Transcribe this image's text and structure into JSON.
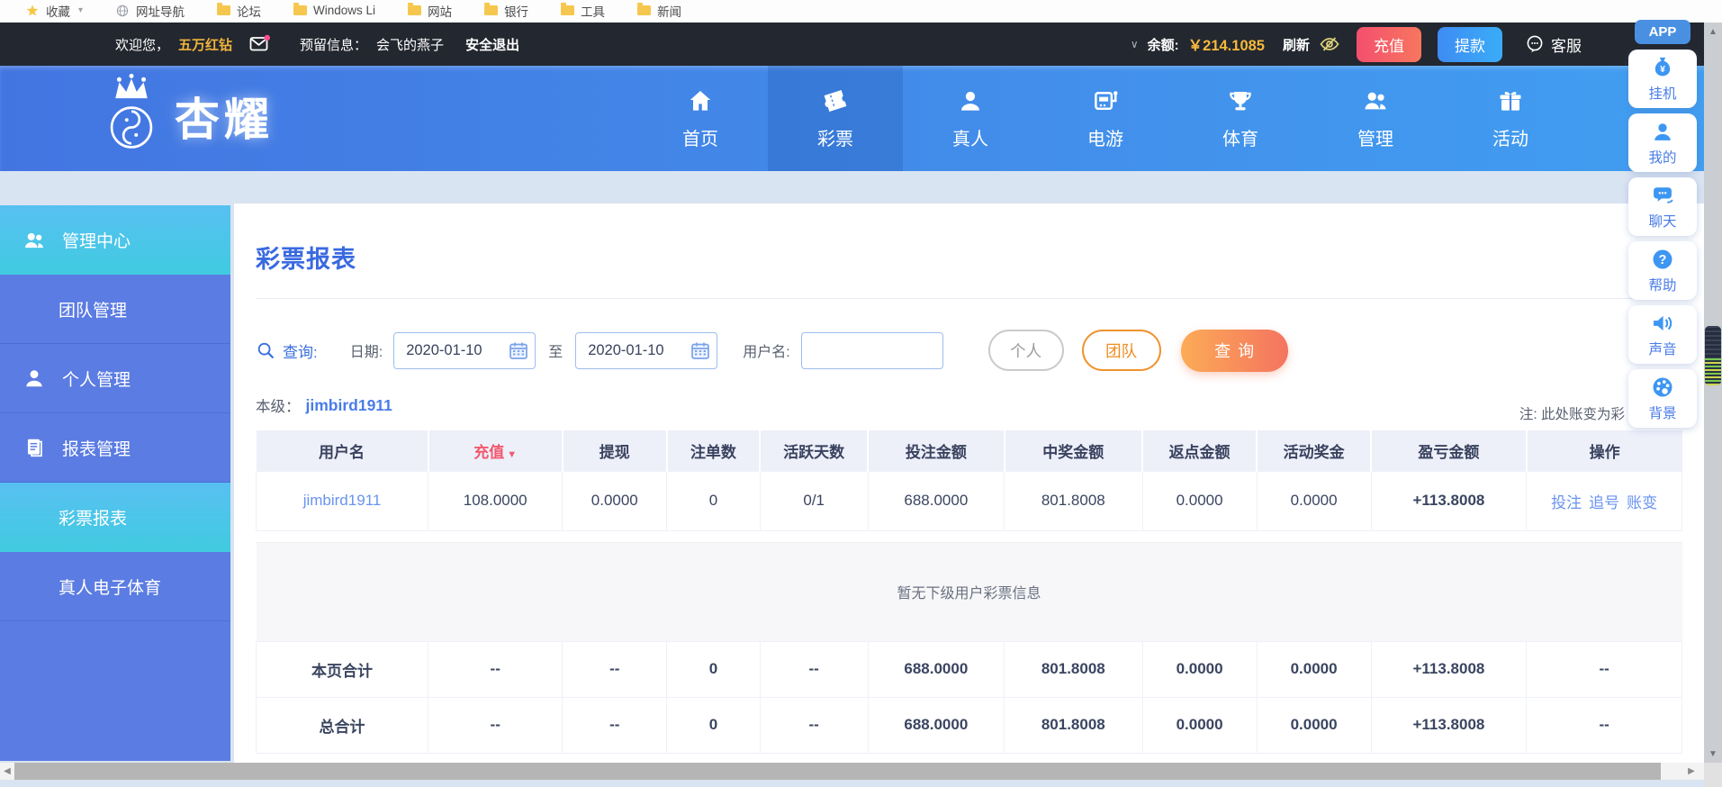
{
  "bookmarks": {
    "items": [
      {
        "label": "收藏",
        "icon": "star-icon"
      },
      {
        "label": "网址导航",
        "icon": "globe-icon"
      },
      {
        "label": "论坛",
        "icon": "folder-icon"
      },
      {
        "label": "Windows Li",
        "icon": "folder-icon"
      },
      {
        "label": "网站",
        "icon": "folder-icon"
      },
      {
        "label": "银行",
        "icon": "folder-icon"
      },
      {
        "label": "工具",
        "icon": "folder-icon"
      },
      {
        "label": "新闻",
        "icon": "folder-icon"
      }
    ]
  },
  "topbar": {
    "welcome_prefix": "欢迎您，",
    "username": "五万红钻",
    "reserved_label": "预留信息：",
    "reserved_value": "会飞的燕子",
    "logout": "安全退出",
    "balance_label": "余额:",
    "balance_value": "￥214.1085",
    "refresh": "刷新",
    "recharge": "充值",
    "withdraw": "提款",
    "service": "客服"
  },
  "navbar": {
    "logo_text": "杏耀",
    "items": [
      {
        "label": "首页",
        "icon": "home-icon"
      },
      {
        "label": "彩票",
        "icon": "ticket-icon",
        "active": true
      },
      {
        "label": "真人",
        "icon": "person-icon"
      },
      {
        "label": "电游",
        "icon": "slot-machine-icon"
      },
      {
        "label": "体育",
        "icon": "trophy-icon"
      },
      {
        "label": "管理",
        "icon": "users-icon"
      },
      {
        "label": "活动",
        "icon": "gift-icon"
      }
    ]
  },
  "side_widgets": {
    "app": "APP",
    "items": [
      {
        "label": "挂机",
        "icon": "moneybag-icon"
      },
      {
        "label": "我的",
        "icon": "user-icon"
      },
      {
        "label": "聊天",
        "icon": "chat-icon"
      },
      {
        "label": "帮助",
        "icon": "question-icon"
      },
      {
        "label": "声音",
        "icon": "speaker-icon"
      },
      {
        "label": "背景",
        "icon": "palette-icon"
      }
    ]
  },
  "sidebar": {
    "items": [
      {
        "label": "管理中心",
        "icon": "users-icon",
        "active": true
      },
      {
        "label": "团队管理"
      },
      {
        "label": "个人管理",
        "icon": "user-icon"
      },
      {
        "label": "报表管理",
        "icon": "report-icon"
      },
      {
        "label": "彩票报表",
        "active": true
      },
      {
        "label": "真人电子体育"
      }
    ]
  },
  "main": {
    "title": "彩票报表",
    "search": {
      "query_label": "查询:",
      "date_label": "日期:",
      "date_from": "2020-01-10",
      "to_label": "至",
      "date_to": "2020-01-10",
      "username_label": "用户名:",
      "username_value": "",
      "personal_btn": "个人",
      "team_btn": "团队",
      "search_btn": "查询"
    },
    "level_label": "本级：",
    "level_user": "jimbird1911",
    "note": "注: 此处账变为彩",
    "table": {
      "columns": [
        "用户名",
        "充值",
        "提现",
        "注单数",
        "活跃天数",
        "投注金额",
        "中奖金额",
        "返点金额",
        "活动奖金",
        "盈亏金额",
        "操作"
      ],
      "rows": [
        {
          "username": "jimbird1911",
          "recharge": "108.0000",
          "withdraw": "0.0000",
          "bets": "0",
          "active_days": "0/1",
          "bet_amount": "688.0000",
          "win_amount": "801.8008",
          "rebate": "0.0000",
          "activity_bonus": "0.0000",
          "profit": "+113.8008",
          "actions": [
            "投注",
            "追号",
            "账变"
          ]
        }
      ],
      "empty_text": "暂无下级用户彩票信息",
      "page_total": {
        "label": "本页合计",
        "cells": [
          "--",
          "--",
          "0",
          "--",
          "688.0000",
          "801.8008",
          "0.0000",
          "0.0000",
          "+113.8008",
          "--"
        ]
      },
      "grand_total": {
        "label": "总合计",
        "cells": [
          "--",
          "--",
          "0",
          "--",
          "688.0000",
          "801.8008",
          "0.0000",
          "0.0000",
          "+113.8008",
          "--"
        ]
      }
    }
  },
  "glyphs": {
    "caret_down": "▾",
    "chevron_down": "∨",
    "sort_down": "▼",
    "scroll_up": "▲",
    "scroll_down": "▼",
    "scroll_left": "◀",
    "scroll_right": "▶",
    "yen": "¥",
    "question": "?"
  },
  "colors": {
    "accent_blue": "#3a6fe0",
    "nav_gradient_start": "#4375e1",
    "nav_gradient_end": "#419ff1",
    "sidebar_blue": "#5b7ce2",
    "sidebar_active_cyan": "#40cbe0",
    "gold": "#f0b43c",
    "recharge_red": "#f44f6e",
    "withdraw_blue": "#3e8cf4",
    "profit_green": "#18a042",
    "link_blue": "#6a93f0",
    "orange_button": "#f4745f"
  }
}
